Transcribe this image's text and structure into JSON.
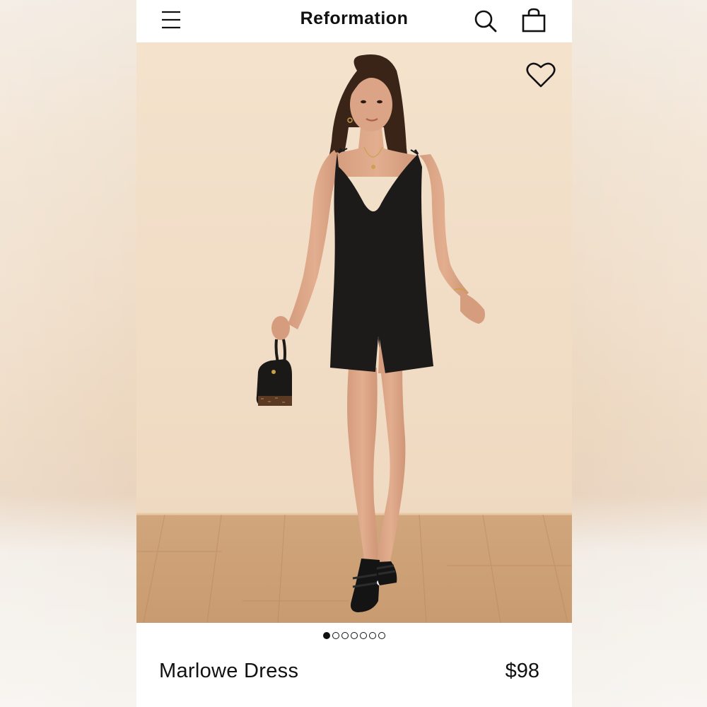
{
  "header": {
    "brand": "Reformation",
    "menu_icon": "hamburger-menu-icon",
    "search_icon": "search-icon",
    "bag_icon": "shopping-bag-icon"
  },
  "hero": {
    "favorite_icon": "heart-icon",
    "image_subject": "product-photo"
  },
  "gallery": {
    "total_images": 7,
    "active_index": 0
  },
  "product": {
    "name": "Marlowe Dress",
    "price": "$98"
  },
  "colors": {
    "background_wall": "#f1dcc4",
    "floor": "#d2a578",
    "dress": "#1c1b1a",
    "text": "#111111"
  }
}
